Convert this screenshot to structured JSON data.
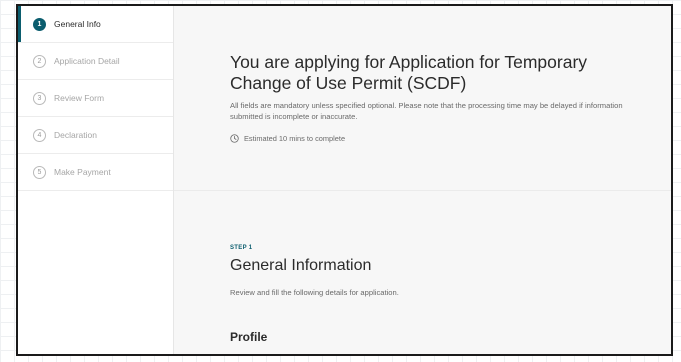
{
  "steps": [
    {
      "num": "1",
      "label": "General Info",
      "active": true
    },
    {
      "num": "2",
      "label": "Application Detail",
      "active": false
    },
    {
      "num": "3",
      "label": "Review Form",
      "active": false
    },
    {
      "num": "4",
      "label": "Declaration",
      "active": false
    },
    {
      "num": "5",
      "label": "Make Payment",
      "active": false
    }
  ],
  "hero": {
    "title": "You are applying for Application for Temporary Change of Use Permit (SCDF)",
    "description": "All fields are mandatory unless specified optional. Please note that the processing time may be delayed if information submitted is incomplete or inaccurate.",
    "estimate": "Estimated 10 mins to complete",
    "estimate_icon": "clock-icon"
  },
  "section": {
    "step_tag": "STEP 1",
    "title": "General Information",
    "description": "Review and fill the following details for application.",
    "profile_heading": "Profile"
  },
  "colors": {
    "accent": "#0b5d6e",
    "panel_bg": "#f7f7f7"
  }
}
